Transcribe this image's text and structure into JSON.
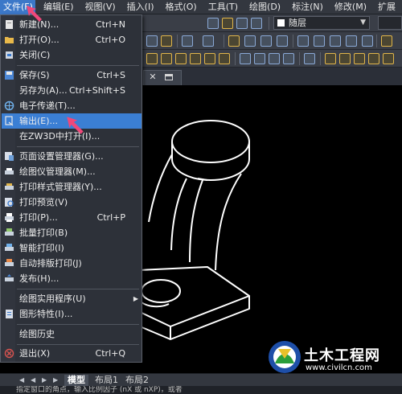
{
  "menubar": {
    "items": [
      {
        "label": "文件(F)",
        "active": true
      },
      {
        "label": "编辑(E)"
      },
      {
        "label": "视图(V)"
      },
      {
        "label": "插入(I)"
      },
      {
        "label": "格式(O)"
      },
      {
        "label": "工具(T)"
      },
      {
        "label": "绘图(D)"
      },
      {
        "label": "标注(N)"
      },
      {
        "label": "修改(M)"
      },
      {
        "label": "扩展"
      }
    ]
  },
  "toolbar": {
    "layer_combo_value": "随层"
  },
  "file_menu": {
    "items": [
      {
        "label": "新建(N)...",
        "shortcut": "Ctrl+N",
        "icon": "new-file-icon"
      },
      {
        "label": "打开(O)...",
        "shortcut": "Ctrl+O",
        "icon": "open-folder-icon"
      },
      {
        "label": "关闭(C)",
        "shortcut": "",
        "icon": "close-file-icon"
      },
      {
        "label": "保存(S)",
        "shortcut": "Ctrl+S",
        "icon": "save-icon"
      },
      {
        "label": "另存为(A)...",
        "shortcut": "Ctrl+Shift+S",
        "icon": ""
      },
      {
        "label": "电子传递(T)...",
        "shortcut": "",
        "icon": "etransmit-icon"
      },
      {
        "label": "输出(E)...",
        "shortcut": "",
        "icon": "export-icon",
        "highlighted": true
      },
      {
        "label": "在ZW3D中打开(I)...",
        "shortcut": "",
        "icon": ""
      },
      {
        "label": "页面设置管理器(G)...",
        "shortcut": "",
        "icon": "page-setup-icon"
      },
      {
        "label": "绘图仪管理器(M)...",
        "shortcut": "",
        "icon": "plotter-icon"
      },
      {
        "label": "打印样式管理器(Y)...",
        "shortcut": "",
        "icon": "plot-style-icon"
      },
      {
        "label": "打印预览(V)",
        "shortcut": "",
        "icon": "print-preview-icon"
      },
      {
        "label": "打印(P)...",
        "shortcut": "Ctrl+P",
        "icon": "print-icon"
      },
      {
        "label": "批量打印(B)",
        "shortcut": "",
        "icon": "batch-print-icon"
      },
      {
        "label": "智能打印(I)",
        "shortcut": "",
        "icon": "smart-print-icon"
      },
      {
        "label": "自动排版打印(J)",
        "shortcut": "",
        "icon": "auto-layout-print-icon"
      },
      {
        "label": "发布(H)...",
        "shortcut": "",
        "icon": "publish-icon"
      },
      {
        "label": "绘图实用程序(U)",
        "shortcut": "",
        "icon": "",
        "submenu": true
      },
      {
        "label": "图形特性(I)...",
        "shortcut": "",
        "icon": "drawing-properties-icon"
      },
      {
        "label": "绘图历史",
        "shortcut": "",
        "icon": ""
      },
      {
        "label": "退出(X)",
        "shortcut": "Ctrl+Q",
        "icon": "exit-icon"
      }
    ]
  },
  "layout_tabs": [
    "模型",
    "布局1",
    "布局2"
  ],
  "command_line": "指定窗口的角点，输入比例因子 (nX 或 nXP)，或者",
  "watermark": {
    "title": "土木工程网",
    "url": "www.civilcn.com"
  },
  "colors": {
    "menu_highlight": "#3b7fd4",
    "pointer_pink": "#f0487a",
    "canvas": "#000000"
  }
}
